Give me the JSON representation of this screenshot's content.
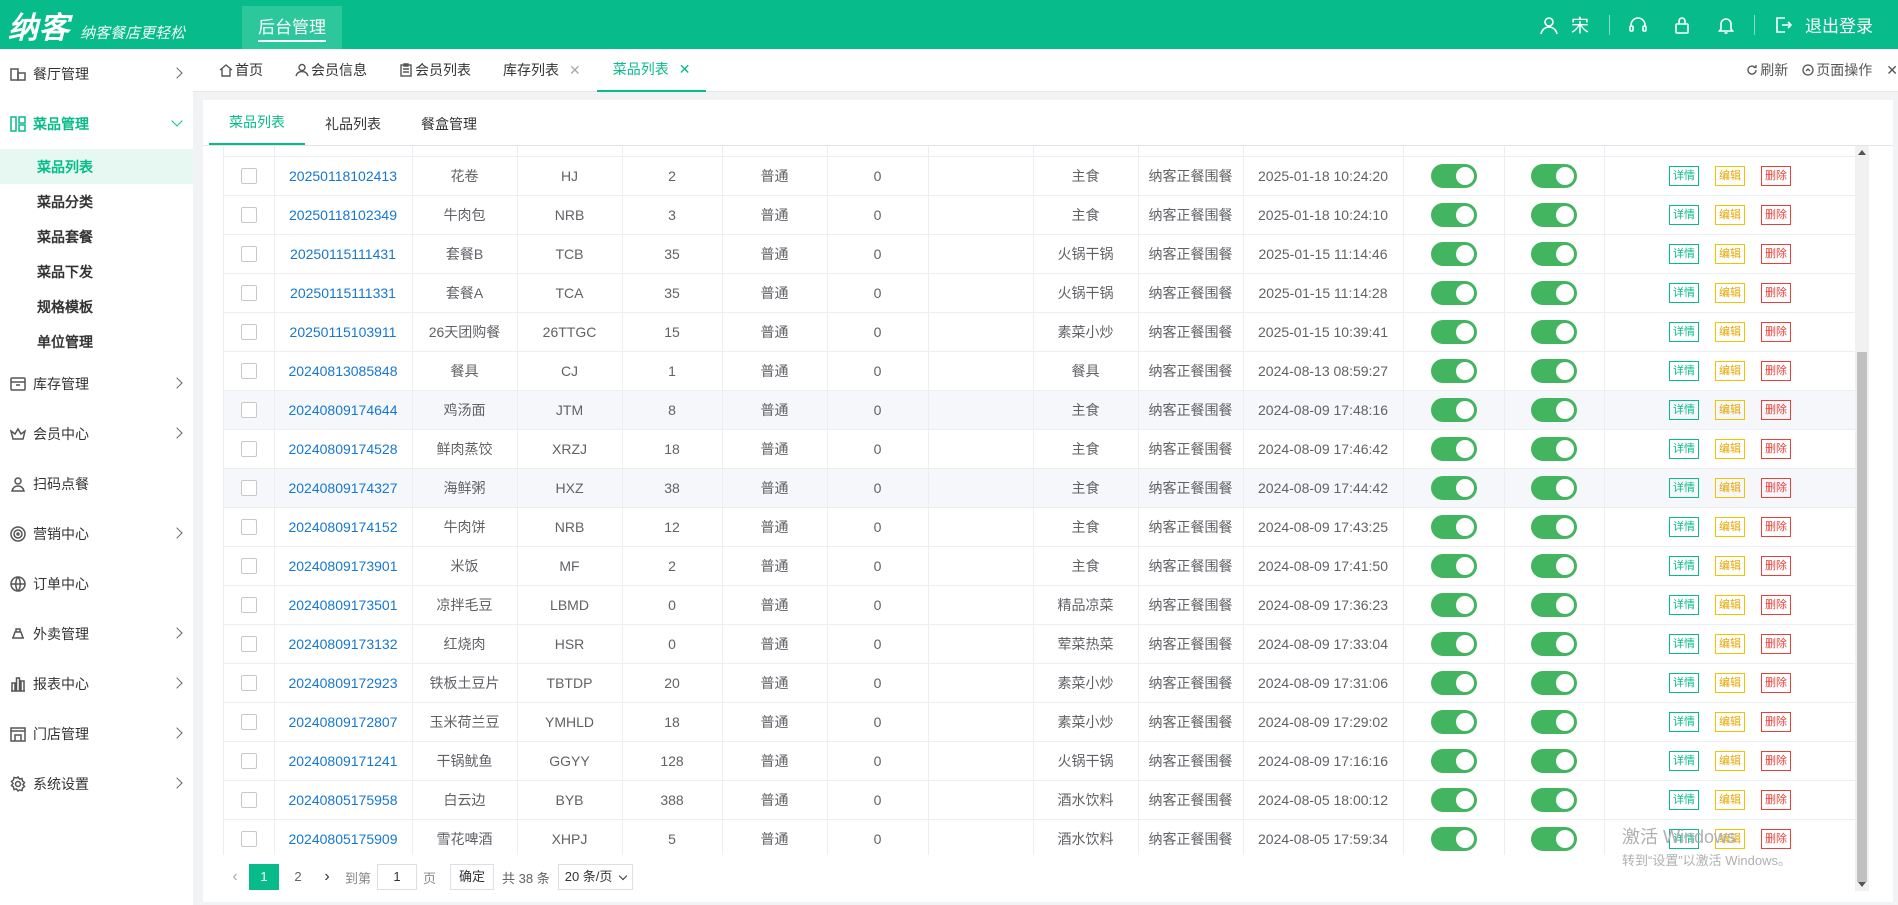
{
  "brand": {
    "logo": "纳客",
    "slogan": "纳客餐店更轻松"
  },
  "topbar": {
    "module_tab": "后台管理",
    "user": "宋",
    "logout": "退出登录"
  },
  "sidebar": {
    "items": [
      {
        "label": "餐厅管理",
        "icon": "restaurant-icon"
      },
      {
        "label": "菜品管理",
        "icon": "grid-icon"
      },
      {
        "label": "库存管理",
        "icon": "inventory-icon"
      },
      {
        "label": "会员中心",
        "icon": "crown-icon"
      },
      {
        "label": "扫码点餐",
        "icon": "user-icon"
      },
      {
        "label": "营销中心",
        "icon": "target-icon"
      },
      {
        "label": "订单中心",
        "icon": "globe-icon"
      },
      {
        "label": "外卖管理",
        "icon": "delivery-icon"
      },
      {
        "label": "报表中心",
        "icon": "report-icon"
      },
      {
        "label": "门店管理",
        "icon": "store-icon"
      },
      {
        "label": "系统设置",
        "icon": "gear-icon"
      }
    ],
    "sub_items": [
      "菜品列表",
      "菜品分类",
      "菜品套餐",
      "菜品下发",
      "规格模板",
      "单位管理"
    ]
  },
  "tabs": {
    "home": "首页",
    "member_info": "会员信息",
    "member_list": "会员列表",
    "stock_list": "库存列表",
    "dish_list": "菜品列表",
    "refresh": "刷新",
    "page_ops": "页面操作"
  },
  "subtabs": [
    "菜品列表",
    "礼品列表",
    "餐盒管理"
  ],
  "row_actions": {
    "detail": "详情",
    "edit": "编辑",
    "delete": "删除"
  },
  "rows": [
    {
      "code": "20250118102413",
      "name": "花卷",
      "abbr": "HJ",
      "price": "2",
      "type": "普通",
      "stock": "0",
      "category": "主食",
      "store": "纳客正餐围餐",
      "time": "2025-01-18 10:24:20"
    },
    {
      "code": "20250118102349",
      "name": "牛肉包",
      "abbr": "NRB",
      "price": "3",
      "type": "普通",
      "stock": "0",
      "category": "主食",
      "store": "纳客正餐围餐",
      "time": "2025-01-18 10:24:10"
    },
    {
      "code": "20250115111431",
      "name": "套餐B",
      "abbr": "TCB",
      "price": "35",
      "type": "普通",
      "stock": "0",
      "category": "火锅干锅",
      "store": "纳客正餐围餐",
      "time": "2025-01-15 11:14:46"
    },
    {
      "code": "20250115111331",
      "name": "套餐A",
      "abbr": "TCA",
      "price": "35",
      "type": "普通",
      "stock": "0",
      "category": "火锅干锅",
      "store": "纳客正餐围餐",
      "time": "2025-01-15 11:14:28"
    },
    {
      "code": "20250115103911",
      "name": "26天团购餐",
      "abbr": "26TTGC",
      "price": "15",
      "type": "普通",
      "stock": "0",
      "category": "素菜小炒",
      "store": "纳客正餐围餐",
      "time": "2025-01-15 10:39:41"
    },
    {
      "code": "20240813085848",
      "name": "餐具",
      "abbr": "CJ",
      "price": "1",
      "type": "普通",
      "stock": "0",
      "category": "餐具",
      "store": "纳客正餐围餐",
      "time": "2024-08-13 08:59:27"
    },
    {
      "code": "20240809174644",
      "name": "鸡汤面",
      "abbr": "JTM",
      "price": "8",
      "type": "普通",
      "stock": "0",
      "category": "主食",
      "store": "纳客正餐围餐",
      "time": "2024-08-09 17:48:16"
    },
    {
      "code": "20240809174528",
      "name": "鲜肉蒸饺",
      "abbr": "XRZJ",
      "price": "18",
      "type": "普通",
      "stock": "0",
      "category": "主食",
      "store": "纳客正餐围餐",
      "time": "2024-08-09 17:46:42"
    },
    {
      "code": "20240809174327",
      "name": "海鲜粥",
      "abbr": "HXZ",
      "price": "38",
      "type": "普通",
      "stock": "0",
      "category": "主食",
      "store": "纳客正餐围餐",
      "time": "2024-08-09 17:44:42"
    },
    {
      "code": "20240809174152",
      "name": "牛肉饼",
      "abbr": "NRB",
      "price": "12",
      "type": "普通",
      "stock": "0",
      "category": "主食",
      "store": "纳客正餐围餐",
      "time": "2024-08-09 17:43:25"
    },
    {
      "code": "20240809173901",
      "name": "米饭",
      "abbr": "MF",
      "price": "2",
      "type": "普通",
      "stock": "0",
      "category": "主食",
      "store": "纳客正餐围餐",
      "time": "2024-08-09 17:41:50"
    },
    {
      "code": "20240809173501",
      "name": "凉拌毛豆",
      "abbr": "LBMD",
      "price": "0",
      "type": "普通",
      "stock": "0",
      "category": "精品凉菜",
      "store": "纳客正餐围餐",
      "time": "2024-08-09 17:36:23"
    },
    {
      "code": "20240809173132",
      "name": "红烧肉",
      "abbr": "HSR",
      "price": "0",
      "type": "普通",
      "stock": "0",
      "category": "荤菜热菜",
      "store": "纳客正餐围餐",
      "time": "2024-08-09 17:33:04"
    },
    {
      "code": "20240809172923",
      "name": "铁板土豆片",
      "abbr": "TBTDP",
      "price": "20",
      "type": "普通",
      "stock": "0",
      "category": "素菜小炒",
      "store": "纳客正餐围餐",
      "time": "2024-08-09 17:31:06"
    },
    {
      "code": "20240809172807",
      "name": "玉米荷兰豆",
      "abbr": "YMHLD",
      "price": "18",
      "type": "普通",
      "stock": "0",
      "category": "素菜小炒",
      "store": "纳客正餐围餐",
      "time": "2024-08-09 17:29:02"
    },
    {
      "code": "20240809171241",
      "name": "干锅鱿鱼",
      "abbr": "GGYY",
      "price": "128",
      "type": "普通",
      "stock": "0",
      "category": "火锅干锅",
      "store": "纳客正餐围餐",
      "time": "2024-08-09 17:16:16"
    },
    {
      "code": "20240805175958",
      "name": "白云边",
      "abbr": "BYB",
      "price": "388",
      "type": "普通",
      "stock": "0",
      "category": "酒水饮料",
      "store": "纳客正餐围餐",
      "time": "2024-08-05 18:00:12"
    },
    {
      "code": "20240805175909",
      "name": "雪花啤酒",
      "abbr": "XHPJ",
      "price": "5",
      "type": "普通",
      "stock": "0",
      "category": "酒水饮料",
      "store": "纳客正餐围餐",
      "time": "2024-08-05 17:59:34"
    }
  ],
  "pagination": {
    "pages": [
      "1",
      "2"
    ],
    "current": "1",
    "goto_label": "到第",
    "goto_value": "1",
    "page_unit": "页",
    "confirm": "确定",
    "total": "共 38 条",
    "page_size": "20 条/页"
  },
  "watermark": {
    "line1": "激活 Windows",
    "line2": "转到“设置”以激活 Windows。"
  }
}
